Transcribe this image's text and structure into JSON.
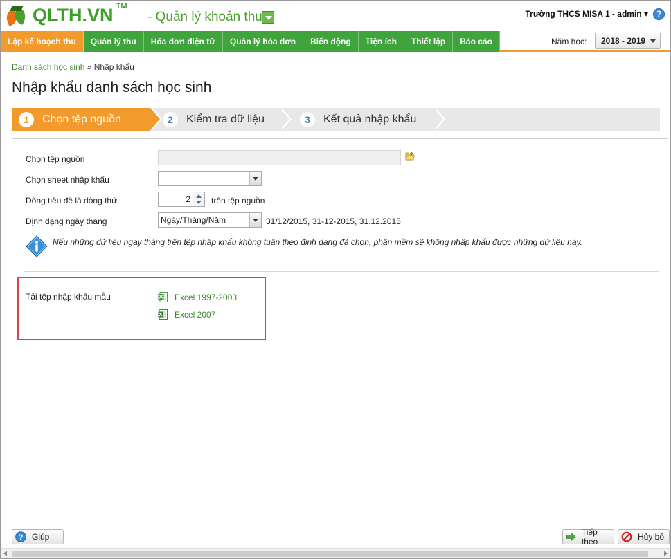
{
  "header": {
    "logo_text": "QLTH.VN",
    "logo_tm": "TM",
    "app_subtitle": "- Quản lý khoản thu",
    "user": "Trường THCS MISA 1 - admin ▾",
    "help_glyph": "?"
  },
  "menu": {
    "items": [
      {
        "label": "Lập kế hoạch thu",
        "active": true
      },
      {
        "label": "Quản lý thu"
      },
      {
        "label": "Hóa đơn điện tử"
      },
      {
        "label": "Quản lý hóa đơn"
      },
      {
        "label": "Biến động"
      },
      {
        "label": "Tiện ích"
      },
      {
        "label": "Thiết lập"
      },
      {
        "label": "Báo cáo"
      }
    ],
    "year_label": "Năm học:",
    "year_value": "2018 - 2019"
  },
  "breadcrumb": {
    "parent": "Danh sách học sinh",
    "separator": " » ",
    "current": "Nhập khẩu"
  },
  "page_title": "Nhập khẩu danh sách học sinh",
  "wizard": {
    "steps": [
      {
        "num": "1",
        "label": "Chọn tệp nguồn"
      },
      {
        "num": "2",
        "label": "Kiểm tra dữ liệu"
      },
      {
        "num": "3",
        "label": "Kết quả nhập khẩu"
      }
    ]
  },
  "form": {
    "source_label": "Chọn tệp nguồn",
    "source_value": "",
    "sheet_label": "Chọn sheet nhập khẩu",
    "sheet_value": "",
    "header_row_label": "Dòng tiêu đề là dòng thứ",
    "header_row_value": "2",
    "header_row_suffix": "trên tệp nguồn",
    "date_format_label": "Định dạng ngày tháng",
    "date_format_value": "Ngày/Tháng/Năm",
    "date_format_example": "31/12/2015, 31-12-2015, 31.12.2015",
    "info_text": "Nếu những dữ liệu ngày tháng trên tệp nhập khẩu không tuân theo định dạng đã chọn, phần mềm sẽ không nhập khẩu được những dữ liệu này."
  },
  "templates": {
    "label": "Tải tệp nhập khẩu mẫu",
    "excel_old": "Excel 1997-2003",
    "excel_new": "Excel 2007"
  },
  "footer": {
    "help": "Giúp",
    "next": "Tiếp theo",
    "cancel": "Hủy bỏ"
  },
  "colors": {
    "brand_green": "#3fa43c",
    "accent_orange": "#f39a2c",
    "link_green": "#3d8a2a",
    "highlight_red": "#d9424a"
  }
}
